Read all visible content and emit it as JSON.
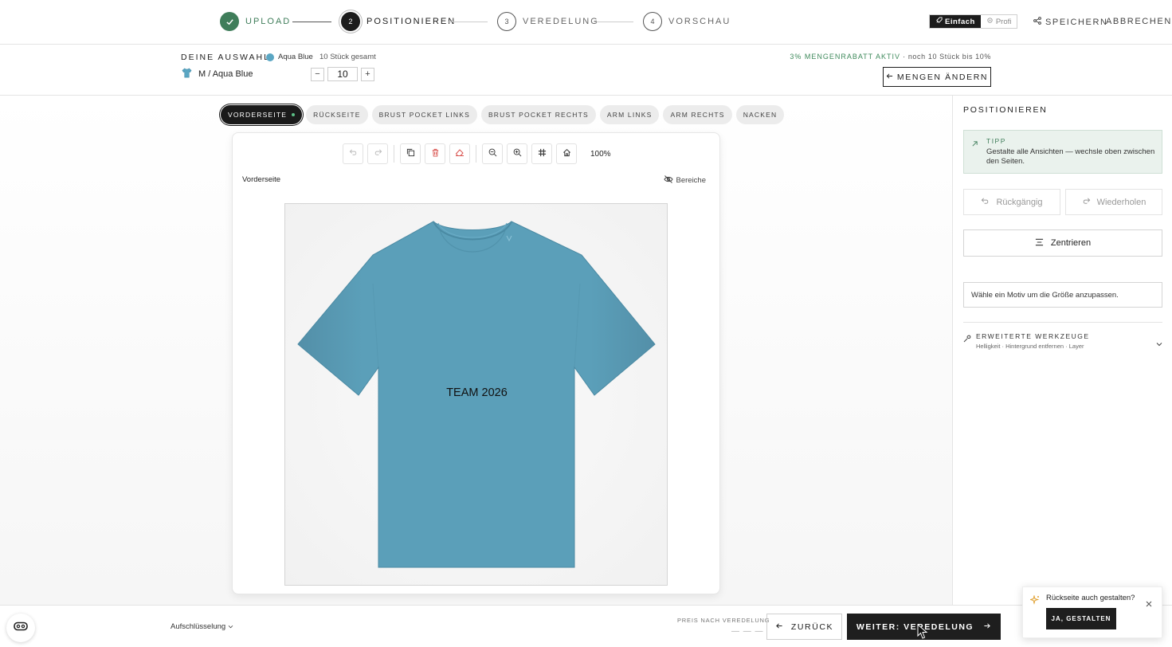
{
  "stepper": {
    "steps": [
      {
        "num": "✓",
        "label": "UPLOAD"
      },
      {
        "num": "2",
        "label": "POSITIONIEREN"
      },
      {
        "num": "3",
        "label": "VEREDELUNG"
      },
      {
        "num": "4",
        "label": "VORSCHAU"
      }
    ]
  },
  "header": {
    "mode_simple": "Einfach",
    "mode_pro": "Profi",
    "save": "SPEICHERN",
    "cancel": "ABBRECHEN"
  },
  "selection": {
    "title": "DEINE AUSWAHL",
    "color_name": "Aqua Blue",
    "color_hex": "#5aa6c3",
    "total": "10 Stück gesamt",
    "item_label": "M / Aqua Blue",
    "quantity": "10",
    "discount_active": "3% MENGENRABATT AKTIV",
    "discount_hint": " · noch 10 Stück bis 10%",
    "change_quantities": "MENGEN ÄNDERN"
  },
  "views": {
    "tabs": [
      "VORDERSEITE",
      "RÜCKSEITE",
      "BRUST POCKET LINKS",
      "BRUST POCKET RECHTS",
      "ARM LINKS",
      "ARM RECHTS",
      "NACKEN"
    ]
  },
  "editor": {
    "zoom": "100%",
    "view_label": "Vorderseite",
    "areas_toggle": "Bereiche",
    "motif_text": "TEAM 2026",
    "shirt_color": "#5b9fb9"
  },
  "panel": {
    "title": "POSITIONIEREN",
    "tip_head": "TIPP",
    "tip_text": "Gestalte alle Ansichten — wechsle oben zwischen den Seiten.",
    "undo": "Rückgängig",
    "redo": "Wiederholen",
    "center": "Zentrieren",
    "hint": "Wähle ein Motiv um die Größe anzupassen.",
    "advanced_title": "ERWEITERTE WERKZEUGE",
    "advanced_sub": "Helligkeit · Hintergrund entfernen · Layer"
  },
  "footer": {
    "breakdown": "Aufschlüsselung",
    "price_label": "PREIS NACH VEREDELUNG",
    "price_value": "— — —",
    "back": "ZURÜCK",
    "next": "WEITER: VEREDELUNG"
  },
  "toast": {
    "text": "Rückseite auch gestalten?",
    "button": "JA, GESTALTEN"
  }
}
